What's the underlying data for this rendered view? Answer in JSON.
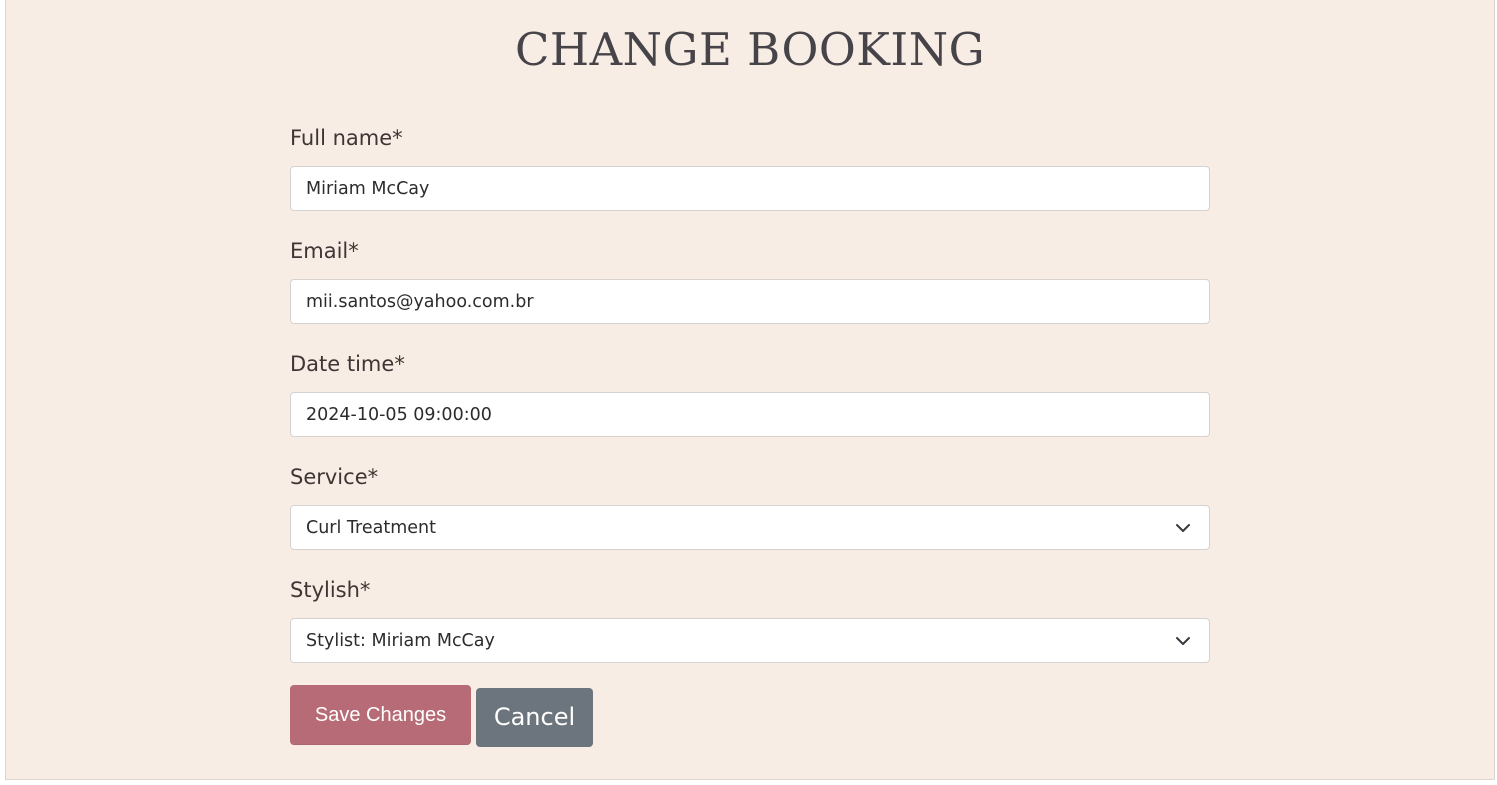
{
  "page": {
    "title": "CHANGE BOOKING"
  },
  "form": {
    "full_name": {
      "label": "Full name*",
      "value": "Miriam McCay"
    },
    "email": {
      "label": "Email*",
      "value": "mii.santos@yahoo.com.br"
    },
    "date_time": {
      "label": "Date time*",
      "value": "2024-10-05 09:00:00"
    },
    "service": {
      "label": "Service*",
      "selected": "Curl Treatment"
    },
    "stylish": {
      "label": "Stylish*",
      "selected": "Stylist: Miriam McCay"
    }
  },
  "actions": {
    "save_label": "Save Changes",
    "cancel_label": "Cancel"
  },
  "colors": {
    "background": "#f7ede4",
    "save_button": "#b76b76",
    "cancel_button": "#6c757d",
    "title_text": "#464349"
  }
}
